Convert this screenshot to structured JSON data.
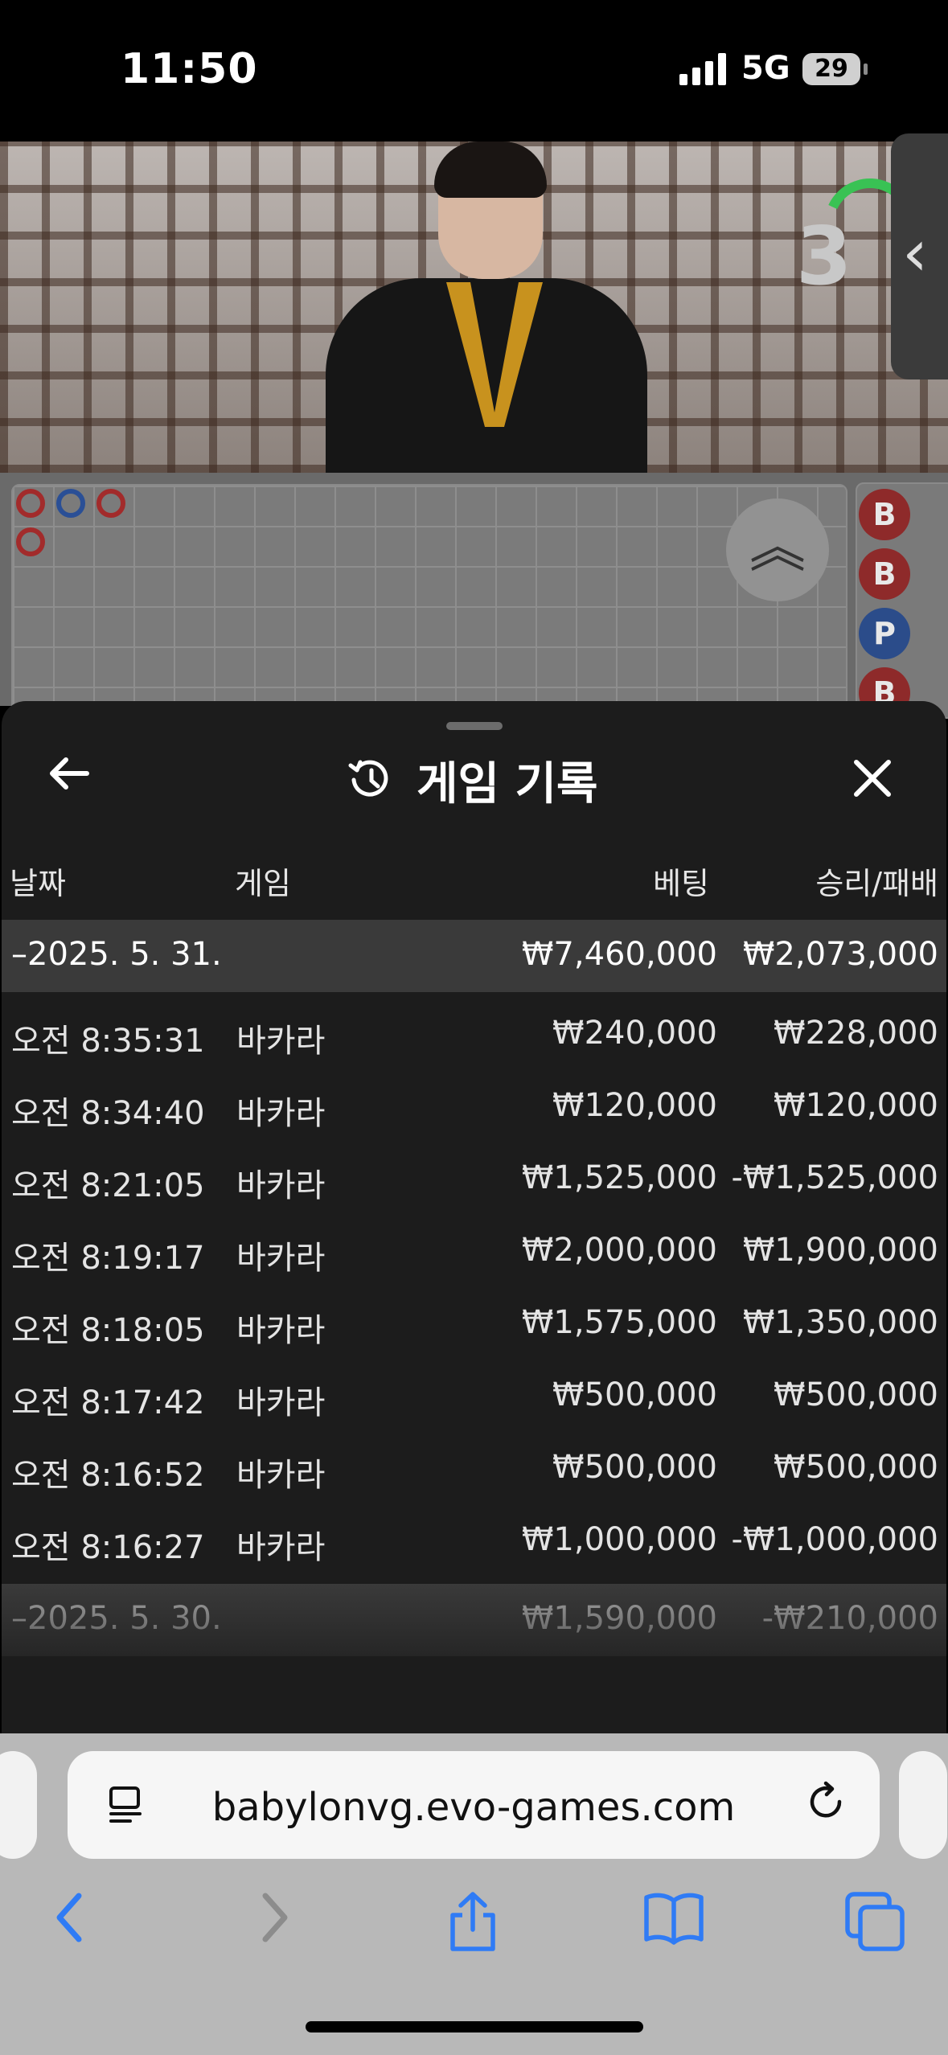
{
  "status_bar": {
    "time": "11:50",
    "network": "5G",
    "battery": "29"
  },
  "game": {
    "countdown": "3",
    "bead_road": [
      "B",
      "B",
      "P",
      "B"
    ]
  },
  "history": {
    "title": "게임 기록",
    "columns": {
      "date": "날짜",
      "game": "게임",
      "bet": "베팅",
      "win_loss": "승리/패배"
    },
    "day1": {
      "date": "–2025. 5. 31.",
      "bet": "₩7,460,000",
      "win_loss": "₩2,073,000"
    },
    "rows": [
      {
        "time": "오전 8:35:31",
        "game": "바카라",
        "bet": "₩240,000",
        "win_loss": "₩228,000"
      },
      {
        "time": "오전 8:34:40",
        "game": "바카라",
        "bet": "₩120,000",
        "win_loss": "₩120,000"
      },
      {
        "time": "오전 8:21:05",
        "game": "바카라",
        "bet": "₩1,525,000",
        "win_loss": "-₩1,525,000"
      },
      {
        "time": "오전 8:19:17",
        "game": "바카라",
        "bet": "₩2,000,000",
        "win_loss": "₩1,900,000"
      },
      {
        "time": "오전 8:18:05",
        "game": "바카라",
        "bet": "₩1,575,000",
        "win_loss": "₩1,350,000"
      },
      {
        "time": "오전 8:17:42",
        "game": "바카라",
        "bet": "₩500,000",
        "win_loss": "₩500,000"
      },
      {
        "time": "오전 8:16:52",
        "game": "바카라",
        "bet": "₩500,000",
        "win_loss": "₩500,000"
      },
      {
        "time": "오전 8:16:27",
        "game": "바카라",
        "bet": "₩1,000,000",
        "win_loss": "-₩1,000,000"
      }
    ],
    "day2": {
      "date": "–2025. 5. 30.",
      "bet": "₩1,590,000",
      "win_loss": "-₩210,000"
    }
  },
  "browser": {
    "url": "babylonvg.evo-games.com",
    "accent": "#2f7bf5"
  }
}
